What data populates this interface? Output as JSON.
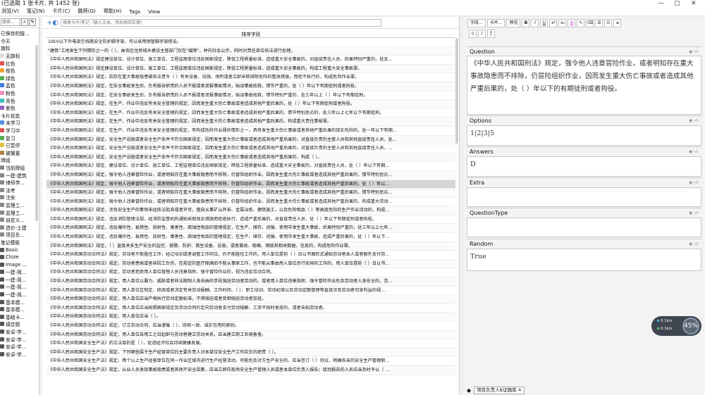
{
  "window": {
    "title": "(已选取 1 张卡片, 共 1452 张)",
    "controls": [
      "—",
      "▢",
      "✕"
    ]
  },
  "menu": [
    "浏览(V)",
    "笔记(N)",
    "卡片(C)",
    "跳转(G)",
    "帮助(H)",
    "Tags",
    "View"
  ],
  "sidebar": {
    "search_placeholder": "搜索...",
    "items": [
      {
        "label": "已保存的搜...",
        "color": ""
      },
      {
        "label": "今天",
        "color": ""
      },
      {
        "label": "旗标",
        "color": ""
      },
      {
        "label": "无旗标",
        "color": "#dddddd"
      },
      {
        "label": "红色",
        "color": "#e05050"
      },
      {
        "label": "橙色",
        "color": "#f0a030"
      },
      {
        "label": "绿色",
        "color": "#50b050"
      },
      {
        "label": "蓝色",
        "color": "#4080e0"
      },
      {
        "label": "粉色",
        "color": "#f090c0"
      },
      {
        "label": "青色",
        "color": "#40c0c0"
      },
      {
        "label": "紫色",
        "color": "#9060c0"
      },
      {
        "label": "卡片状态",
        "color": ""
      },
      {
        "label": "未学习",
        "color": "#5090e0"
      },
      {
        "label": "学习中",
        "color": "#e05050"
      },
      {
        "label": "复习",
        "color": "#50b050"
      },
      {
        "label": "已暂停",
        "color": "#e0c040"
      },
      {
        "label": "被搁置",
        "color": "#b08040"
      },
      {
        "label": "牌组",
        "color": ""
      },
      {
        "label": "当前牌组",
        "color": "#888888"
      },
      {
        "label": "一建-建筑",
        "color": "#888888"
      },
      {
        "label": "律师学...",
        "color": "#888888"
      },
      {
        "label": "法考",
        "color": "#888888"
      },
      {
        "label": "注安",
        "color": "#888888"
      },
      {
        "label": "监理工...",
        "color": "#888888"
      },
      {
        "label": "监理工...",
        "color": "#888888"
      },
      {
        "label": "自定义...",
        "color": "#888888"
      },
      {
        "label": "造价-土建",
        "color": "#888888"
      },
      {
        "label": "项目负...",
        "color": "#888888"
      },
      {
        "label": "笔记模板",
        "color": ""
      },
      {
        "label": "Basic",
        "color": "#555555"
      },
      {
        "label": "Cloze",
        "color": "#555555"
      },
      {
        "label": "Image ...",
        "color": "#555555"
      },
      {
        "label": "一建-简...",
        "color": "#555555"
      },
      {
        "label": "一建-简...",
        "color": "#555555"
      },
      {
        "label": "一建-简...",
        "color": "#555555"
      },
      {
        "label": "一建-简...",
        "color": "#555555"
      },
      {
        "label": "基本模...",
        "color": "#555555"
      },
      {
        "label": "基本模...",
        "color": "#555555"
      },
      {
        "label": "基础卡...",
        "color": "#555555"
      },
      {
        "label": "填空题",
        "color": "#555555"
      },
      {
        "label": "安卓-学...",
        "color": "#555555"
      },
      {
        "label": "安卓-学...",
        "color": "#555555"
      },
      {
        "label": "安卓-学...",
        "color": "#555555"
      },
      {
        "label": "安卓-学...",
        "color": "#555555"
      }
    ]
  },
  "center": {
    "search_placeholder": "搜索卡片/笔记（输入文本，然后按回车键）",
    "column_header": "排序字段",
    "selected_index": 16,
    "rows": [
      "10kV以下外电架空线路安全防护脚手架，可以采用钢管脚手架搭设。",
      "\"建筑\"工地发生下列情形之一的（ ），由各区住房城乡建设主管部门仅在\"缓降\"，并向社会公示，同时对责任单位依法进行处理。",
      "《中华人民共和国刑法》规定建设单位、设计单位、施工单位、工程监理单位违反国家规定，降低工程质量标准，造成重大安全事故的，对直接责任人员，后果特别严重的，处五...",
      "《中华人民共和国刑法》规定建设单位、设计单位、施工单位、工程监理单位违反国家规定，降低工程质量标准，造成重大安全事故的，构成工程重大安全事故罪。",
      "《中华人民共和国刑法》规定，因存在重大事故隐患被依法责令（ ）有关设备、设施、场所或者立即采取排除危险的整改措施，而拒不执行的，构成危险作业罪。",
      "《中华人民共和国刑法》规定，在安全事故发生后，负有报告职责的人员不报或者谎报事故情况，贻误事故抢救，情节严重的，处（ ）年以下有期徒刑或者拘役。",
      "《中华人民共和国刑法》规定，在安全事故发生后，负有报告职责的人员不报或者谎报事故情况，贻误事故抢救，情节特别严重的，处三年以上（ ）年以下有期徒刑。",
      "《中华人民共和国刑法》规定，在生产、作业中违反有关安全管理的规定，因而发生重大伤亡事故或者造成其他严重后果的，处（ ）年以下有期徒刑或者拘役。",
      "《中华人民共和国刑法》规定，在生产、作业中违反有关安全管理的规定，因而发生重大伤亡事故或者造成其他严重后果的，情节特别恶劣的，处三年以上七年以下有期徒刑。",
      "《中华人民共和国刑法》规定，在生产、作业中违反有关安全管理的规定，因而发生重大伤亡事故或者造成其他严重后果的，构成重大责任事故罪。",
      "《中华人民共和国刑法》规定，在生产、作业中违反有关安全管理的规定，有构成危险作业罪的情形之一，具有发生重大伤亡事故或者其他严重后果的现实危险的，处一年以下有期...",
      "《中华人民共和国刑法》规定，安全生产设施或者安全生产条件不符合国家规定，因而发生重大伤亡事故或者造成其他严重后果的，对直接负责的主管人员和其他直接责任人员，处...",
      "《中华人民共和国刑法》规定，安全生产设施或者安全生产条件不符合国家规定，因而发生重大伤亡事故或者造成其他严重后果的，对直接负责的主管人员和其他直接责任人员，...",
      "《中华人民共和国刑法》规定，安全生产设施或者安全生产条件不符合国家规定，因而发生重大伤亡事故或者造成其他严重后果的，构成（ ）。",
      "《中华人民共和国刑法》规定，建设单位、设计单位、施工单位、工程监理单位违反国家规定，降低工程质量标准，造成重大安全事故的，对直接责任人员，处（ ）年以下有期...",
      "《中华人民共和国刑法》规定，强令他人违章冒险作业，或者明知存在重大事故隐患而不排除，仍冒险组织作业，因而发生重大伤亡事故或者造成其他严重后果的，情节特别恶劣...",
      "《中华人民共和国刑法》规定，强令他人违章冒险作业，或者明知存在重大事故隐患而不排除，仍冒险组织作业，因而发生重大伤亡事故或者造成其他严重后果的，处（ ）年以...",
      "《中华人民共和国刑法》规定，强令他人违章冒险作业，或者明知存在重大事故隐患而不排除，仍冒险组织作业，因而发生重大伤亡事故或者造成其他严重后果的，情节特别恶劣...",
      "《中华人民共和国刑法》规定，强令他人违章冒险作业，或者明知存在重大事故隐患而不排除，仍冒险组织作业，因而发生重大伤亡事故或者造成其他严重后果的，构成重大劳动...",
      "《中华人民共和国刑法》规定，涉及安全生产的事项未经依法批准或者许可，擅自从事矿山开采、金属冶炼、建筑施工，以及危险物品（ ）等高度危险的生产作业活动的，构成...",
      "《中华人民共和国刑法》规定，违反消防管理法规，经消防监督机构通知采取改正措施而拒绝执行，造成严重后果的，对直接责任人员，处（ ）年以下有期徒刑或者拘役。",
      "《中华人民共和国刑法》规定，违反爆炸性、易燃性、放射性、毒害性、腐蚀性物品的管理规定，在生产、储存、运输、使用中发生重大事故，后果特别严重的，处三年以上七年...",
      "《中华人民共和国刑法》规定，违反爆炸性、易燃性、放射性、毒害性、腐蚀性物品的管理规定，在生产、储存、运输、使用中发生重大事故，造成严重后果的，处（ ）年以下...",
      "《中华人民共和国刑法》规定，（ ）直接关系生产安全的监控、报警、防护、救生设备、设施，或者篡改、隐瞒、销毁其相关数据、信息的，构成危险作业罪。",
      "《中华人民共和国劳动合同法》规定，劳动者不能胜任工作，经过培训或者调整工作岗位，仍不能胜任工作的，用人单位提前（ ）日以书面形式通知劳动者本人或者额外支付劳...",
      "《中华人民共和国劳动合同法》规定，劳动者患病或者非因工负伤，在规定的医疗期满后不能从事原工作，也不能从事由用人单位另行安排的工作的，用人单位提前（ ）日以书...",
      "《中华人民共和国劳动合同法》规定，劳动者拒绝用人单位管理人员违章指挥、强令冒险作业的，视为违反劳动合同。",
      "《中华人民共和国劳动合同法》规定，用人单位以暴力、威胁或者非法限制人身自由的手段强迫劳动者劳动的，或者用人单位违章指挥、强令冒险作业危及劳动者人身安全的，劳...",
      "《中华人民共和国劳动合同法》规定，用人单位在制定、修改或者决定有关劳动报酬、工作时间、（ ）、职工培训、劳动纪律以及劳动定额管理等直接涉及劳动者切身利益的规...",
      "《中华人民共和国劳动合同法》规定，用人单位应当严格执行劳动定额标准，不得强迫或者变相强迫劳动者加班。",
      "《中华人民共和国劳动合同法》规定，用人单位应当按照国家规定及劳动合同约定向劳动者支付劳动报酬，工资不按时发放的，或者告知劳动者。",
      "《中华人民共和国劳动合同法》规定，用人单位应当（ ）。",
      "《中华人民共和国劳动合同法》规定，订立劳动合同，应当遵循（ ）、协商一致、诚实信用的原则。",
      "《中华人民共和国劳动合同法》规定，用人单位自用工之日起即与劳动者建立劳动关系，应当建立职工名册备查。",
      "《中华人民共和国安全生产法》的立法目的是（ ），促进经济社会持续健康发展。",
      "《中华人民共和国安全生产法》规定，下列哪些属于生产经营单位的主要负责人对本单位安全生产工作应负的职责（ ）。",
      "《中华人民共和国安全生产法》规定，两个以上生产经营单位在同一作业区域内进行生产经营活动，可能危及对方生产安全的，应当签订（ ）协议，明确各自的安全生产管理职...",
      "《中华人民共和国安全生产法》规定，从业人员发现事故隐患或者其他不安全因素，应当立即向现场安全生产管理人员或者本单位负责人报告；接到报告的人员应当及时予以（ ..."
    ]
  },
  "editor": {
    "toolbar": {
      "fields_btn": "字段...",
      "cards_btn": "卡片...",
      "preview_btn": "预览",
      "bold": "B",
      "italic": "I",
      "underline": "U",
      "superscript": "x²",
      "subscript": "x₂",
      "text_color": "A",
      "highlight": "✎",
      "erase": "⌫",
      "ul": "☰",
      "ol": "☷",
      "align": "≡"
    },
    "fields": [
      {
        "name": "Question",
        "value": "《中华人民共和国刑法》规定，强令他人违章冒险作业，或者明知存在重大事故隐患而不排除，仍冒险组织作业，因而发生重大伤亡事故或者造成其他严重后果的，处（ ）年以下的有期徒刑或者拘役。"
      },
      {
        "name": "Options",
        "value": "1|2|3|5"
      },
      {
        "name": "Answers",
        "value": "D"
      },
      {
        "name": "Extra",
        "value": ""
      },
      {
        "name": "QuestionType",
        "value": ""
      },
      {
        "name": "Random",
        "value": "True"
      }
    ],
    "tag": "项目负责人B证题库 ✕"
  },
  "net_badge": {
    "up": "0.1k/s",
    "down": "0.1k/s",
    "percent": "45%",
    "up_color": "#36d2ff",
    "down_color": "#4be37a"
  }
}
